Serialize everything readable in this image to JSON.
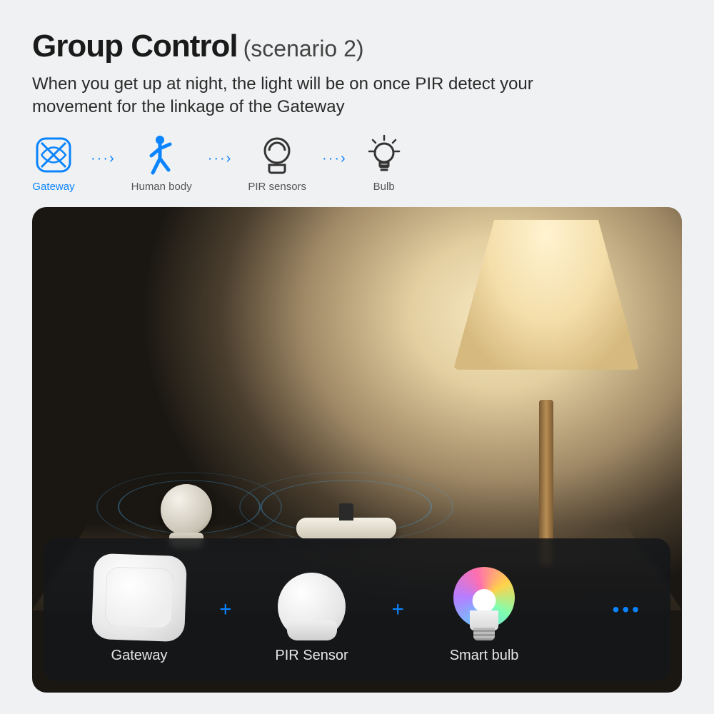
{
  "title": {
    "main": "Group Control",
    "sub": "(scenario 2)"
  },
  "description": "When you get up at night, the light will be on once PIR detect your movement for the linkage of the Gateway",
  "flow": {
    "gateway": "Gateway",
    "human": "Human body",
    "pir": "PIR sensors",
    "bulb": "Bulb"
  },
  "bar": {
    "gateway": "Gateway",
    "pir": "PIR Sensor",
    "bulb": "Smart bulb",
    "plus": "+",
    "more": "•••"
  },
  "colors": {
    "accent": "#0a84ff"
  }
}
